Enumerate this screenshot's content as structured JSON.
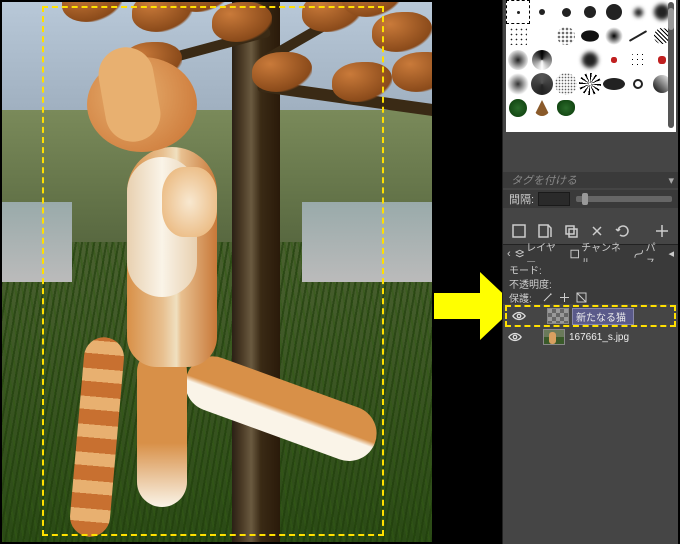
{
  "tags": {
    "placeholder": "タグを付ける",
    "menu": "▾"
  },
  "spacing": {
    "label": "間隔:",
    "value": ""
  },
  "tabs": {
    "chevron": "‹",
    "layers": "レイヤー",
    "channels": "チャンネル",
    "paths": "パス",
    "menu": "◂"
  },
  "sections": {
    "mode": "モード:",
    "opacity": "不透明度:",
    "lock": "保護:"
  },
  "layers": [
    {
      "visible": true,
      "thumb": "trans",
      "name": "新たなる猫",
      "editing": true
    },
    {
      "visible": true,
      "thumb": "img",
      "name": "167661_s.jpg",
      "editing": false
    }
  ]
}
